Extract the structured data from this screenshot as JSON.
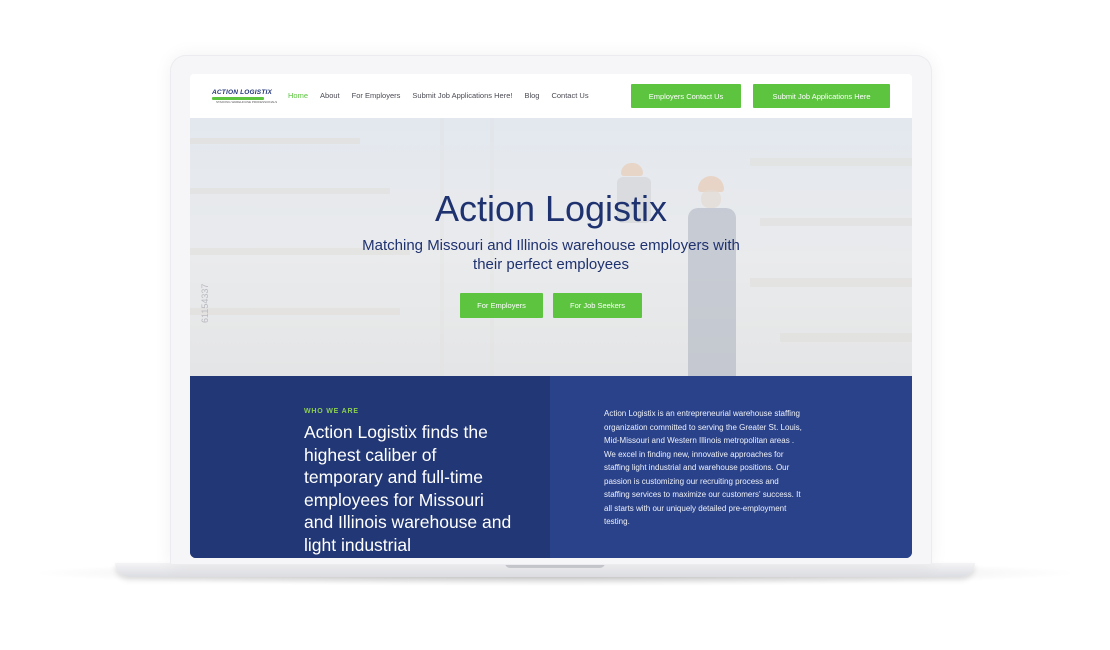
{
  "header": {
    "logo_text": "ACTION LOGISTIX",
    "logo_sub": "STAFFING WAREHOUSE PROFESSIONALS",
    "nav": [
      "Home",
      "About",
      "For Employers",
      "Submit Job Applications Here!",
      "Blog",
      "Contact Us"
    ],
    "buttons": {
      "employers_contact": "Employers Contact Us",
      "submit_applications": "Submit Job Applications Here"
    }
  },
  "hero": {
    "title": "Action Logistix",
    "subtitle": "Matching Missouri and Illinois warehouse employers with their perfect employees",
    "cta_employers": "For Employers",
    "cta_seekers": "For Job Seekers",
    "watermark": "61154337"
  },
  "about": {
    "kicker": "WHO WE ARE",
    "headline": "Action Logistix finds the highest caliber of temporary and full-time employees for Missouri and Illinois warehouse and light industrial",
    "body": "Action Logistix is an entrepreneurial warehouse staffing organization committed to serving the Greater St. Louis, Mid-Missouri and Western Illinois metropolitan areas . We excel in finding new, innovative approaches for staffing light industrial and warehouse positions. Our passion is customizing our recruiting process and staffing services to maximize our customers' success. It all starts with our uniquely detailed pre-employment testing."
  },
  "colors": {
    "brand_green": "#5cc43f",
    "brand_navy": "#1f3270",
    "section_blue": "#2a428a"
  }
}
